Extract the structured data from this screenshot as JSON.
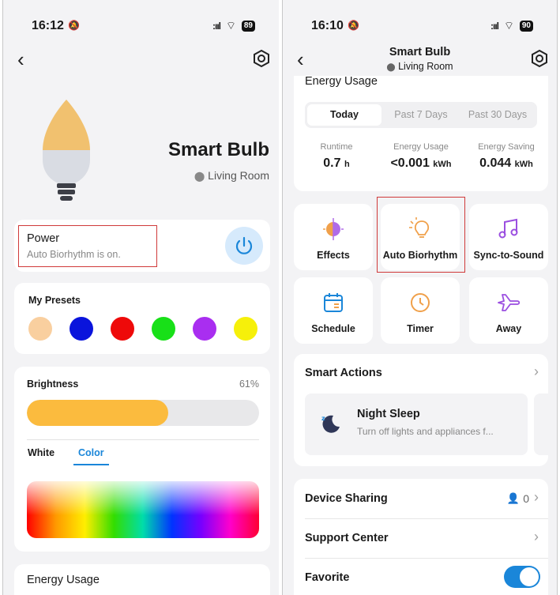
{
  "left": {
    "status": {
      "time": "16:12",
      "signal": ":ııl",
      "battery": "89"
    },
    "device": {
      "title": "Smart Bulb",
      "location": "Living Room"
    },
    "power": {
      "label": "Power",
      "subtitle": "Auto Biorhythm is on."
    },
    "presets": {
      "title": "My Presets",
      "colors": [
        "#f9cf9f",
        "#0a14dc",
        "#ee0a0a",
        "#18e018",
        "#a92ef0",
        "#f6f00a"
      ]
    },
    "brightness": {
      "title": "Brightness",
      "value_label": "61%",
      "level": 0.61
    },
    "mode_tabs": [
      "White",
      "Color"
    ],
    "energy_title": "Energy Usage"
  },
  "right": {
    "status": {
      "time": "16:10",
      "signal": ":ııl",
      "battery": "90"
    },
    "header": {
      "title": "Smart Bulb",
      "location": "Living Room"
    },
    "energy": {
      "title": "Energy Usage",
      "tabs": [
        "Today",
        "Past 7 Days",
        "Past 30 Days"
      ],
      "stats": [
        {
          "label": "Runtime",
          "value": "0.7",
          "unit": "h"
        },
        {
          "label": "Energy Usage",
          "value": "<0.001",
          "unit": "kWh"
        },
        {
          "label": "Energy Saving",
          "value": "0.044",
          "unit": "kWh"
        }
      ]
    },
    "features": [
      "Effects",
      "Auto Biorhythm",
      "Sync-to-Sound",
      "Schedule",
      "Timer",
      "Away"
    ],
    "smart_actions": {
      "title": "Smart Actions",
      "item_title": "Night Sleep",
      "item_subtitle": "Turn off lights and appliances f..."
    },
    "device_sharing": {
      "label": "Device Sharing",
      "count": "0"
    },
    "support": {
      "label": "Support Center"
    },
    "favorite": {
      "label": "Favorite"
    }
  },
  "colors": {
    "accent": "#1a86d9",
    "highlight": "#d03a3a",
    "brightness_fill": "#fbbb3e",
    "toggle_on": "#1a86d9"
  }
}
